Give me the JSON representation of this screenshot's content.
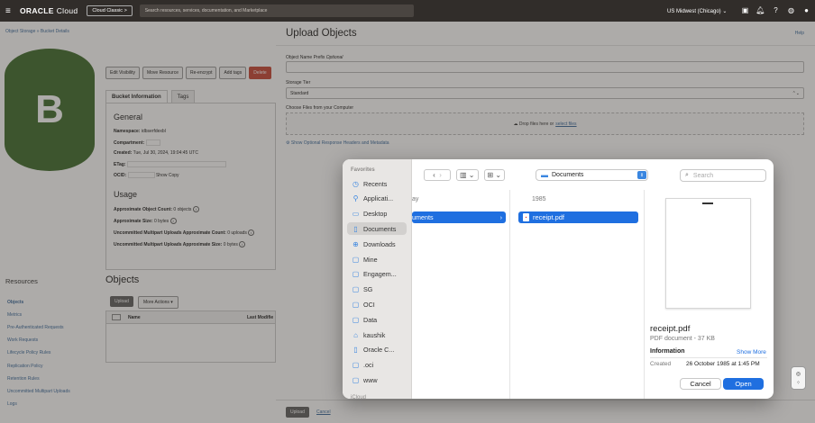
{
  "topbar": {
    "logo_oracle": "ORACLE",
    "logo_cloud": "Cloud",
    "classic_label": "Cloud Classic >",
    "search_placeholder": "Search resources, services, documentation, and Marketplace",
    "region": "US Midwest (Chicago) ⌄"
  },
  "bucket": {
    "breadcrumb": "Object Storage » Bucket Details",
    "avatar_letter": "B",
    "actions": [
      "Edit Visibility",
      "Move Resource",
      "Re-encrypt",
      "Add tags",
      "Delete"
    ],
    "tabs": [
      "Bucket Information",
      "Tags"
    ],
    "general_heading": "General",
    "namespace_label": "Namespace:",
    "namespace_value": "idbserfdexbl",
    "compartment_label": "Compartment:",
    "created_label": "Created:",
    "created_value": "Tue, Jul 30, 2024, 19:04:45 UTC",
    "etag_label": "ETag:",
    "ocid_label": "OCID:",
    "ocid_actions": "Show  Copy",
    "usage_heading": "Usage",
    "usage": [
      {
        "label": "Approximate Object Count:",
        "value": "0 objects"
      },
      {
        "label": "Approximate Size:",
        "value": "0 bytes"
      },
      {
        "label": "Uncommitted Multipart Uploads Approximate Count:",
        "value": "0 uploads"
      },
      {
        "label": "Uncommitted Multipart Uploads Approximate Size:",
        "value": "0 bytes"
      }
    ]
  },
  "resources": {
    "heading": "Resources",
    "items": [
      "Objects",
      "Metrics",
      "Pre-Authenticated Requests",
      "Work Requests",
      "Lifecycle Policy Rules",
      "Replication Policy",
      "Retention Rules",
      "Uncommitted Multipart Uploads",
      "Logs"
    ]
  },
  "objects": {
    "heading": "Objects",
    "upload_label": "Upload",
    "more_actions_label": "More Actions ▾",
    "columns": [
      "Name",
      "Last Modifie"
    ]
  },
  "drawer": {
    "title": "Upload Objects",
    "help": "Help",
    "prefix_label": "Object Name Prefix",
    "prefix_optional": "Optional",
    "tier_label": "Storage Tier",
    "tier_value": "Standard",
    "choose_label": "Choose Files from your Computer",
    "drop_text": "Drop files here or",
    "select_files": "select files",
    "optional_headers": "Show Optional Response Headers and Metadata",
    "upload_btn": "Upload",
    "cancel_btn": "Cancel"
  },
  "dialog": {
    "favorites_label": "Favorites",
    "sidebar": [
      {
        "label": "Recents",
        "icon": "clock-icon",
        "selected": false
      },
      {
        "label": "Applicati...",
        "icon": "apps-icon",
        "selected": false
      },
      {
        "label": "Desktop",
        "icon": "desktop-icon",
        "selected": false
      },
      {
        "label": "Documents",
        "icon": "document-icon",
        "selected": true
      },
      {
        "label": "Downloads",
        "icon": "download-icon",
        "selected": false
      },
      {
        "label": "Mine",
        "icon": "folder-icon",
        "selected": false
      },
      {
        "label": "Engagem...",
        "icon": "folder-icon",
        "selected": false
      },
      {
        "label": "SG",
        "icon": "folder-icon",
        "selected": false
      },
      {
        "label": "OCI",
        "icon": "folder-icon",
        "selected": false
      },
      {
        "label": "Data",
        "icon": "folder-icon",
        "selected": false
      },
      {
        "label": "kaushik",
        "icon": "home-icon",
        "selected": false
      },
      {
        "label": "Oracle C...",
        "icon": "document-icon",
        "selected": false
      },
      {
        "label": ".oci",
        "icon": "folder-icon",
        "selected": false
      },
      {
        "label": "www",
        "icon": "folder-icon",
        "selected": false
      }
    ],
    "icloud_label": "iCloud",
    "location": "Documents",
    "search_placeholder": "Search",
    "col1_header": "ay",
    "col1_selected": "uments",
    "col2_header": "1985",
    "file_name": "receipt.pdf",
    "preview_name": "receipt.pdf",
    "preview_type": "PDF document - 37 KB",
    "info_label": "Information",
    "show_more": "Show More",
    "created_label": "Created",
    "created_value": "26 October 1985 at 1:45 PM",
    "cancel_label": "Cancel",
    "open_label": "Open"
  },
  "colors": {
    "topbar": "#312d2a",
    "avatar": "#3f6c2b",
    "accent_blue": "#1f6fe0",
    "delete_red": "#c74634",
    "link": "#3b6a9c"
  }
}
